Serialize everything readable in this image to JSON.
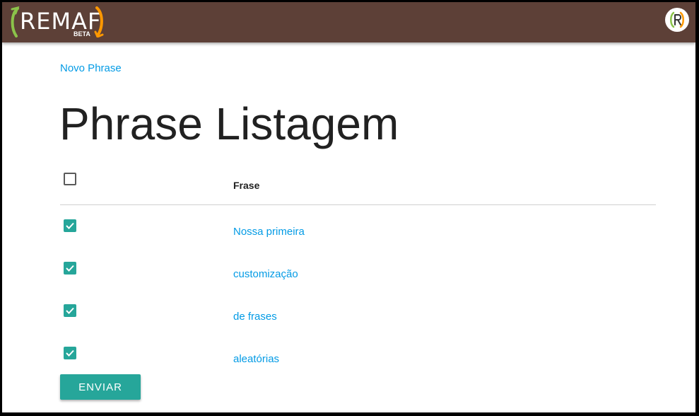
{
  "header": {
    "logo_text": "REMAF",
    "logo_badge": "BETA",
    "avatar_icon": "remaf-avatar-icon",
    "colors": {
      "bar": "#5d4037",
      "logo_green": "#8bc34a",
      "logo_orange": "#ff9800"
    }
  },
  "nav": {
    "new_link": "Novo Phrase"
  },
  "page": {
    "title": "Phrase Listagem"
  },
  "table": {
    "header": {
      "select_all_checked": false,
      "column": "Frase"
    },
    "rows": [
      {
        "checked": true,
        "frase": "Nossa primeira"
      },
      {
        "checked": true,
        "frase": "customização"
      },
      {
        "checked": true,
        "frase": "de frases"
      },
      {
        "checked": true,
        "frase": "aleatórias"
      }
    ]
  },
  "form": {
    "submit_label": "ENVIAR"
  },
  "colors": {
    "accent": "#26a69a",
    "link": "#039be5"
  }
}
